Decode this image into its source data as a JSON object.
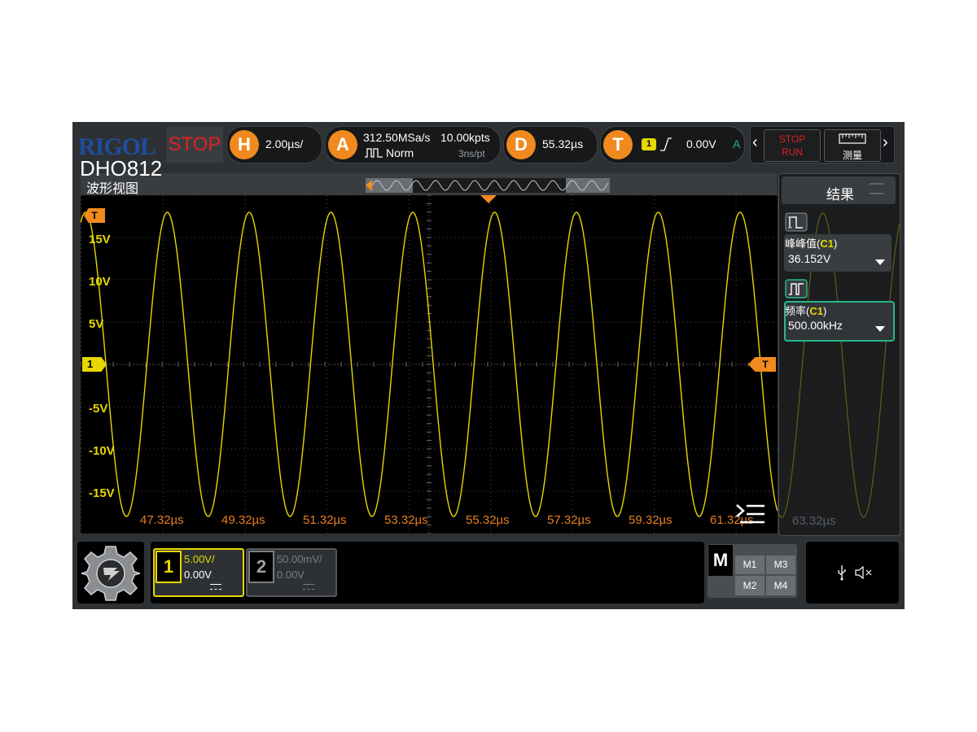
{
  "header": {
    "brand": "RIGOL",
    "model": "DHO812",
    "run_state": "STOP",
    "horizontal": {
      "letter": "H",
      "timebase": "2.00µs/"
    },
    "acquire": {
      "letter": "A",
      "sample_rate": "312.50MSa/s",
      "memory_depth": "10.00kpts",
      "mode": "Norm",
      "resolution": "3ns/pt"
    },
    "delay": {
      "letter": "D",
      "value": "55.32µs"
    },
    "trigger": {
      "letter": "T",
      "source": "1",
      "level": "0.00V",
      "status": "A"
    },
    "controls": {
      "stop_label": "STOP",
      "run_label": "RUN",
      "measure_label": "测量"
    }
  },
  "waveform_view": {
    "title": "波形视图",
    "y_labels": [
      "15V",
      "10V",
      "5V",
      "-5V",
      "-10V",
      "-15V"
    ],
    "x_labels": [
      "47.32µs",
      "49.32µs",
      "51.32µs",
      "53.32µs",
      "55.32µs",
      "57.32µs",
      "59.32µs",
      "61.32µs",
      "63.32µs"
    ],
    "channel_marker": "1",
    "trigger_marker": "T",
    "trace_color": "#e6d800"
  },
  "results": {
    "title": "结果",
    "items": [
      {
        "name": "峰峰值",
        "source": "C1",
        "value": "36.152V"
      },
      {
        "name": "频率",
        "source": "C1",
        "value": "500.00kHz"
      }
    ]
  },
  "channels": [
    {
      "number": "1",
      "scale": "5.00V/",
      "offset": "0.00V",
      "active": true
    },
    {
      "number": "2",
      "scale": "50.00mV/",
      "offset": "0.00V",
      "active": false
    }
  ],
  "math": {
    "label": "M",
    "items": [
      "M1",
      "M3",
      "M2",
      "M4"
    ]
  },
  "colors": {
    "accent": "#f08a1e",
    "channel1": "#e6d800",
    "brand_blue": "#1d4ea0",
    "stop_red": "#e02020",
    "teal": "#27b88a"
  }
}
